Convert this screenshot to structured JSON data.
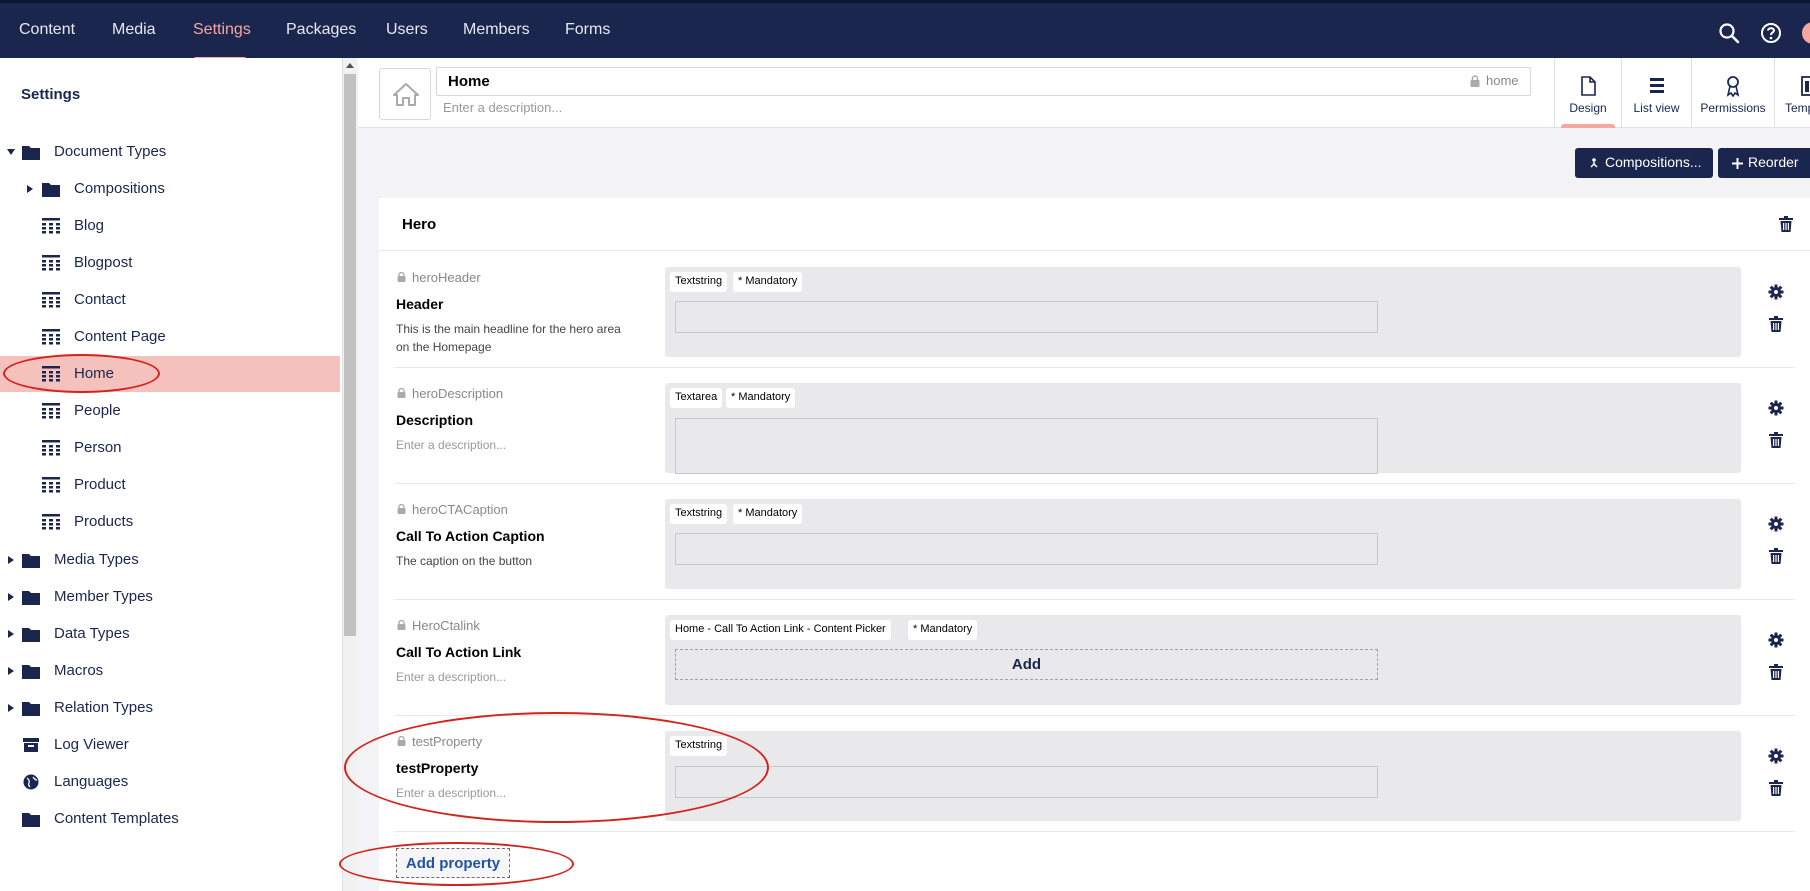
{
  "topnav": {
    "items": [
      "Content",
      "Media",
      "Settings",
      "Packages",
      "Users",
      "Members",
      "Forms"
    ],
    "active": "Settings"
  },
  "sidebar": {
    "title": "Settings",
    "tree": {
      "document_types": "Document Types",
      "compositions": "Compositions",
      "blog": "Blog",
      "blogpost": "Blogpost",
      "contact": "Contact",
      "content_page": "Content Page",
      "home": "Home",
      "people": "People",
      "person": "Person",
      "product": "Product",
      "products": "Products",
      "media_types": "Media Types",
      "member_types": "Member Types",
      "data_types": "Data Types",
      "macros": "Macros",
      "relation_types": "Relation Types",
      "log_viewer": "Log Viewer",
      "languages": "Languages",
      "content_templates": "Content Templates"
    }
  },
  "header": {
    "name": "Home",
    "alias": "home",
    "description_placeholder": "Enter a description...",
    "tabs": {
      "design": "Design",
      "list_view": "List view",
      "permissions": "Permissions",
      "templates": "Temp"
    }
  },
  "toolbar": {
    "compositions": "Compositions...",
    "reorder": "Reorder"
  },
  "group": {
    "title": "Hero",
    "properties": [
      {
        "alias": "heroHeader",
        "label": "Header",
        "description": "This is the main headline for the hero area on the Homepage",
        "editor": "Textstring",
        "mandatory": "* Mandatory"
      },
      {
        "alias": "heroDescription",
        "label": "Description",
        "description": "Enter a description...",
        "editor": "Textarea",
        "mandatory": "* Mandatory"
      },
      {
        "alias": "heroCTACaption",
        "label": "Call To Action Caption",
        "description": "The caption on the button",
        "editor": "Textstring",
        "mandatory": "* Mandatory"
      },
      {
        "alias": "HeroCtalink",
        "label": "Call To Action Link",
        "description": "Enter a description...",
        "editor": "Home - Call To Action Link - Content Picker",
        "mandatory": "* Mandatory",
        "add_label": "Add"
      },
      {
        "alias": "testProperty",
        "label": "testProperty",
        "description": "Enter a description...",
        "editor": "Textstring"
      }
    ],
    "add_property": "Add property"
  },
  "colors": {
    "topbar": "#1b264f",
    "accent": "#f5a7a0",
    "selected": "#f5c1bc",
    "annotation": "#d4231c"
  }
}
